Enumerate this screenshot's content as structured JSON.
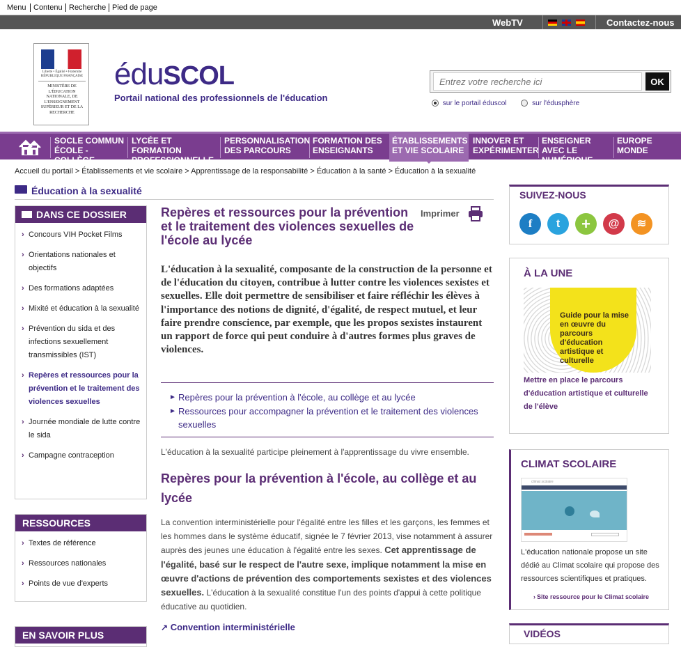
{
  "skip_links": [
    "Menu",
    "Contenu",
    "Recherche",
    "Pied de page"
  ],
  "top": {
    "webtv": "WebTV",
    "contact": "Contactez-nous"
  },
  "brand": {
    "name_part1": "édu",
    "name_part2": "SCOL",
    "tagline": "Portail national des professionnels de l'éducation",
    "ministry_text": "MINISTÈRE DE L'ÉDUCATION NATIONALE, DE L'ENSEIGNEMENT SUPÉRIEUR ET DE LA RECHERCHE",
    "rf_text": "Liberté • Égalité • Fraternité RÉPUBLIQUE FRANÇAISE"
  },
  "search": {
    "placeholder": "Entrez votre recherche ici",
    "button": "OK",
    "option1": "sur le portail éduscol",
    "option2": "sur l'édusphère"
  },
  "nav": [
    "SOCLE COMMUN ÉCOLE - COLLÈGE",
    "LYCÉE ET FORMATION PROFESSIONNELLE",
    "PERSONNALISATION DES PARCOURS",
    "FORMATION DES ENSEIGNANTS",
    "ÉTABLISSEMENTS ET VIE SCOLAIRE",
    "INNOVER ET EXPÉRIMENTER",
    "ENSEIGNER AVEC LE NUMÉRIQUE",
    "EUROPE MONDE"
  ],
  "breadcrumb": "Accueil du portail > Établissements et vie scolaire > Apprentissage de la responsabilité > Éducation à la santé > Éducation à la sexualité",
  "section_title": "Éducation à la sexualité",
  "dossier": {
    "title": "DANS CE DOSSIER",
    "items": [
      "Concours VIH Pocket Films",
      "Orientations nationales et objectifs",
      "Des formations adaptées",
      "Mixité et éducation à la sexualité",
      "Prévention du sida et des infections sexuellement transmissibles (IST)",
      "Repères et ressources pour la prévention et le traitement des violences sexuelles",
      "Journée mondiale de lutte contre le sida",
      "Campagne contraception"
    ]
  },
  "ressources": {
    "title": "RESSOURCES",
    "items": [
      "Textes de référence",
      "Ressources nationales",
      "Points de vue d'experts"
    ]
  },
  "en_savoir": {
    "title": "EN SAVOIR PLUS"
  },
  "article": {
    "title": "Repères et ressources pour la prévention et le traitement des violences sexuelles de l'école au lycée",
    "print": "Imprimer",
    "intro": "L'éducation à la sexualité, composante de la construction de la personne et de l'éducation du citoyen, contribue à lutter contre les violences sexistes et sexuelles. Elle doit permettre de sensibiliser et faire réfléchir les élèves à l'importance des notions de dignité, d'égalité, de respect mutuel, et leur faire prendre conscience, par exemple, que les propos sexistes instaurent un rapport de force qui peut conduire à d'autres formes plus graves de violences.",
    "toc": [
      "Repères pour la prévention à l'école, au collège et au lycée",
      "Ressources pour accompagner la prévention et le traitement des violences sexuelles"
    ],
    "lead": "L'éducation à la sexualité participe pleinement à l'apprentissage du vivre ensemble.",
    "h2": "Repères pour la prévention à l'école, au collège et au lycée",
    "para_normal1": "La  convention interministérielle pour l'égalité entre les filles et les garçons, les femmes et les hommes dans le système éducatif, signée le 7 février 2013, vise notamment à assurer auprès des jeunes une éducation à l'égalité entre les sexes.",
    "para_bold": "Cet apprentissage de l'égalité, basé sur le respect de l'autre sexe, implique notamment la mise en œuvre d'actions de prévention des comportements sexistes et des violences sexuelles.",
    "para_normal2": "L'éducation à la sexualité constitue l'un des points d'appui à cette politique éducative au quotidien.",
    "link": "Convention interministérielle"
  },
  "suivez": {
    "title": "SUIVEZ-NOUS",
    "icons": [
      "facebook-icon",
      "twitter-icon",
      "plus-icon",
      "mail-icon",
      "rss-icon"
    ]
  },
  "une": {
    "title": "À LA UNE",
    "image_text": "Guide pour la mise en œuvre du parcours d'éducation artistique et culturelle",
    "caption": "Mettre en place le parcours d'éducation artistique et culturelle de l'élève"
  },
  "climat": {
    "title": "CLIMAT SCOLAIRE",
    "text": "L'éducation nationale propose un site dédié au Climat scolaire qui propose des ressources scientifiques et pratiques.",
    "link": "Site ressource pour le Climat scolaire",
    "thumb_label": "climat scolaire"
  },
  "videos": {
    "title": "VIDÉOS"
  },
  "colors": {
    "purple": "#5b2d74",
    "nav": "#7a3d8f",
    "grey": "#555555"
  }
}
